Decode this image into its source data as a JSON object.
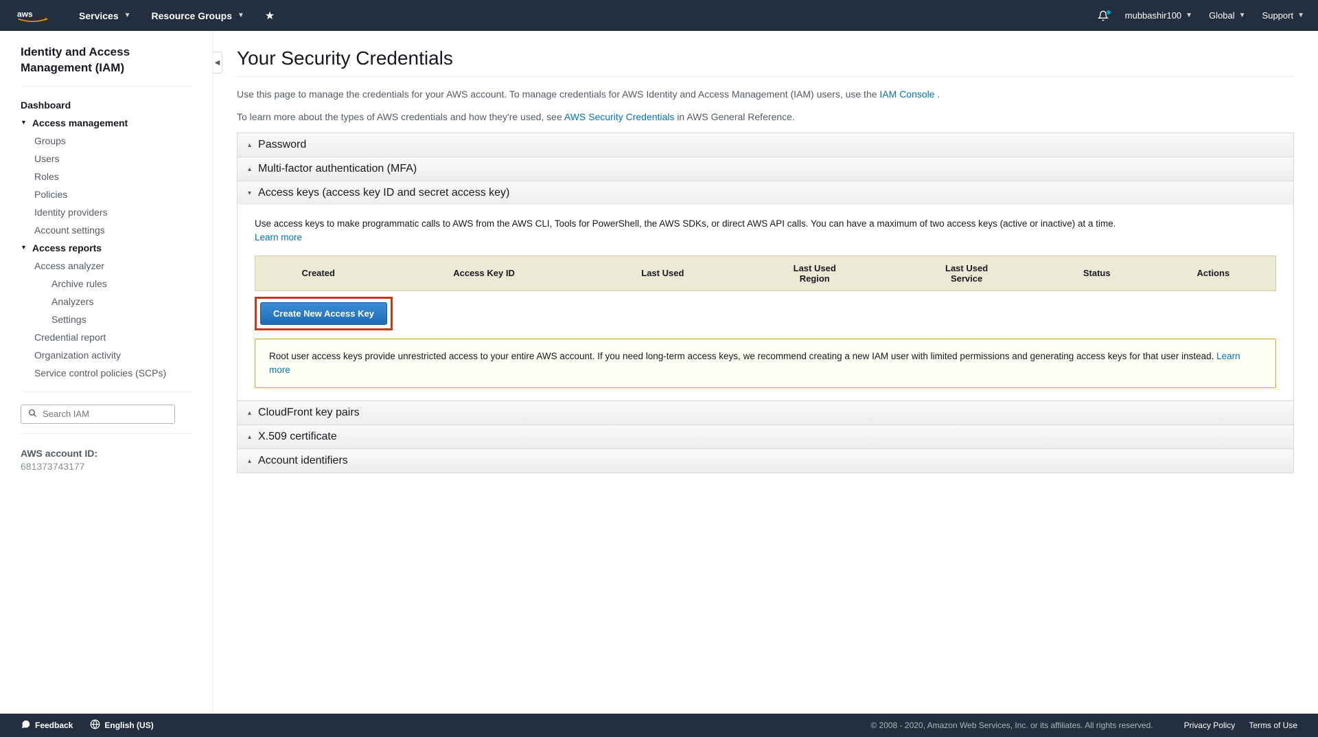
{
  "topbar": {
    "services": "Services",
    "resourceGroups": "Resource Groups",
    "user": "mubbashir100",
    "region": "Global",
    "support": "Support"
  },
  "sidebar": {
    "title": "Identity and Access Management (IAM)",
    "dashboard": "Dashboard",
    "accessMgmt": {
      "label": "Access management",
      "items": [
        "Groups",
        "Users",
        "Roles",
        "Policies",
        "Identity providers",
        "Account settings"
      ]
    },
    "accessReports": {
      "label": "Access reports",
      "items": [
        "Access analyzer",
        "Credential report",
        "Organization activity",
        "Service control policies (SCPs)"
      ],
      "analyzerSub": [
        "Archive rules",
        "Analyzers",
        "Settings"
      ]
    },
    "search": {
      "placeholder": "Search IAM"
    },
    "accountLabel": "AWS account ID:",
    "accountId": "681373743177"
  },
  "page": {
    "title": "Your Security Credentials",
    "intro1a": "Use this page to manage the credentials for your AWS account. To manage credentials for AWS Identity and Access Management (IAM) users, use the ",
    "intro1link": "IAM Console",
    "intro1b": " .",
    "intro2a": "To learn more about the types of AWS credentials and how they're used, see ",
    "intro2link": "AWS Security Credentials",
    "intro2b": " in AWS General Reference."
  },
  "accordion": {
    "password": "Password",
    "mfa": "Multi-factor authentication (MFA)",
    "accessKeys": "Access keys (access key ID and secret access key)",
    "accessKeysDesc": "Use access keys to make programmatic calls to AWS from the AWS CLI, Tools for PowerShell, the AWS SDKs, or direct AWS API calls. You can have a maximum of two access keys (active or inactive) at a time.",
    "learnMore": "Learn more",
    "tableHeaders": [
      "Created",
      "Access Key ID",
      "Last Used",
      "Last Used Region",
      "Last Used Service",
      "Status",
      "Actions"
    ],
    "createBtn": "Create New Access Key",
    "warning": "Root user access keys provide unrestricted access to your entire AWS account. If you need long-term access keys, we recommend creating a new IAM user with limited permissions and generating access keys for that user instead.  ",
    "warningLink": "Learn more",
    "cloudfront": "CloudFront key pairs",
    "x509": "X.509 certificate",
    "accountIds": "Account identifiers"
  },
  "footer": {
    "feedback": "Feedback",
    "language": "English (US)",
    "copyright": "© 2008 - 2020, Amazon Web Services, Inc. or its affiliates. All rights reserved.",
    "privacy": "Privacy Policy",
    "terms": "Terms of Use"
  }
}
